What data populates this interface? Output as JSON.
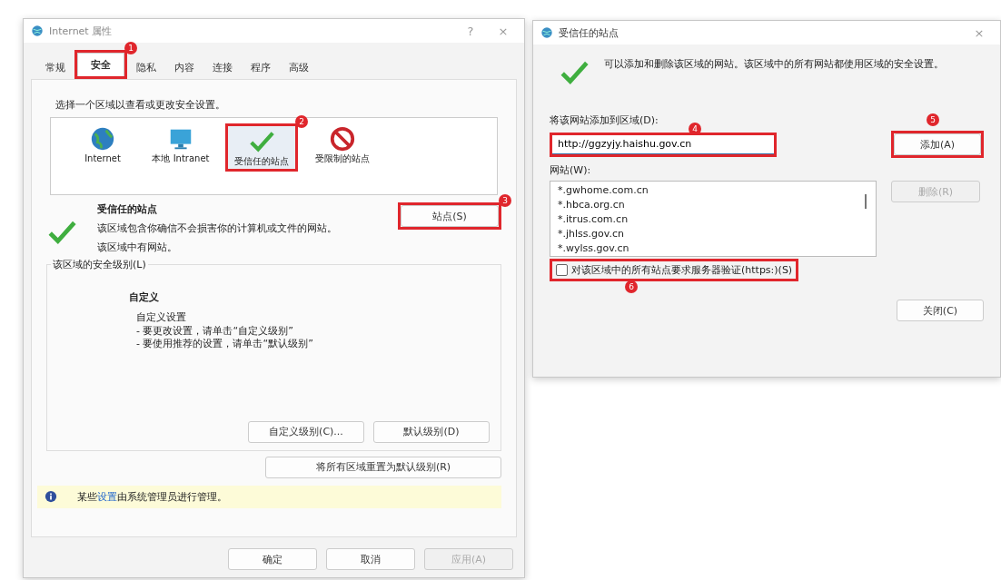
{
  "left_dialog": {
    "title": "Internet 属性",
    "help": "?",
    "close": "×",
    "tabs": [
      {
        "label": "常规",
        "selected": false
      },
      {
        "label": "安全",
        "selected": true,
        "callout": "1"
      },
      {
        "label": "隐私",
        "selected": false
      },
      {
        "label": "内容",
        "selected": false
      },
      {
        "label": "连接",
        "selected": false
      },
      {
        "label": "程序",
        "selected": false
      },
      {
        "label": "高级",
        "selected": false
      }
    ],
    "zone_prompt": "选择一个区域以查看或更改安全设置。",
    "zones": [
      {
        "label": "Internet",
        "kind": "globe",
        "selected": false
      },
      {
        "label": "本地 Intranet",
        "kind": "intranet",
        "selected": false
      },
      {
        "label": "受信任的站点",
        "kind": "trusted",
        "selected": true,
        "callout": "2"
      },
      {
        "label": "受限制的站点",
        "kind": "restricted",
        "selected": false
      }
    ],
    "zone_info": {
      "title": "受信任的站点",
      "description": "该区域包含你确信不会损害你的计算机或文件的网站。",
      "status": "该区域中有网站。",
      "sites_button": {
        "label": "站点(S)",
        "callout": "3"
      }
    },
    "security_level": {
      "legend": "该区域的安全级别(L)",
      "level_name": "自定义",
      "lines": [
        "自定义设置",
        "- 要更改设置，请单击“自定义级别”",
        "- 要使用推荐的设置，请单击“默认级别”"
      ],
      "buttons": [
        "自定义级别(C)...",
        "默认级别(D)"
      ]
    },
    "reset_button": "将所有区域重置为默认级别(R)",
    "info_bar": {
      "before": "某些",
      "link": "设置",
      "after": "由系统管理员进行管理。"
    },
    "footer_buttons": [
      {
        "label": "确定",
        "disabled": false
      },
      {
        "label": "取消",
        "disabled": false
      },
      {
        "label": "应用(A)",
        "disabled": true
      }
    ]
  },
  "right_dialog": {
    "title": "受信任的站点",
    "close": "×",
    "description": "可以添加和删除该区域的网站。该区域中的所有网站都使用区域的安全设置。",
    "add_label": "将该网站添加到区域(D):",
    "url_field": {
      "value": "http://ggzyjy.haishu.gov.cn",
      "callout": "4"
    },
    "add_button": {
      "label": "添加(A)",
      "callout": "5"
    },
    "sites_label": "网站(W):",
    "sites": [
      "*.gwhome.com.cn",
      "*.hbca.org.cn",
      "*.itrus.com.cn",
      "*.jhlss.gov.cn",
      "*.wylss.gov.cn"
    ],
    "remove_button": {
      "label": "删除(R)",
      "disabled": true
    },
    "https_checkbox": {
      "label": "对该区域中的所有站点要求服务器验证(https:)(S)",
      "checked": false,
      "callout": "6"
    },
    "close_button": "关闭(C)"
  }
}
